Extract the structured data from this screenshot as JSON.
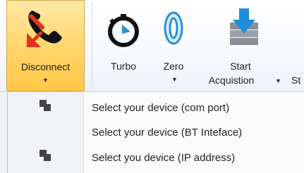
{
  "ribbon": {
    "disconnect": {
      "label": "Disconnect"
    },
    "turbo": {
      "label": "Turbo"
    },
    "zero": {
      "label": "Zero"
    },
    "start": {
      "label_line1": "Start",
      "label_line2": "Acquistion",
      "next_partial": "St"
    }
  },
  "menu": {
    "items": [
      {
        "label": "Select your device (com port)",
        "icon": "device-icon"
      },
      {
        "label": "Select your device (BT Inteface)",
        "icon": ""
      },
      {
        "label": "Select you device (IP address)",
        "icon": "device-icon"
      }
    ]
  },
  "colors": {
    "selected_bg": "#ffd872",
    "accent_red": "#e2331f",
    "accent_blue": "#2b8fd6",
    "menu_bg": "#fbfbfc"
  }
}
